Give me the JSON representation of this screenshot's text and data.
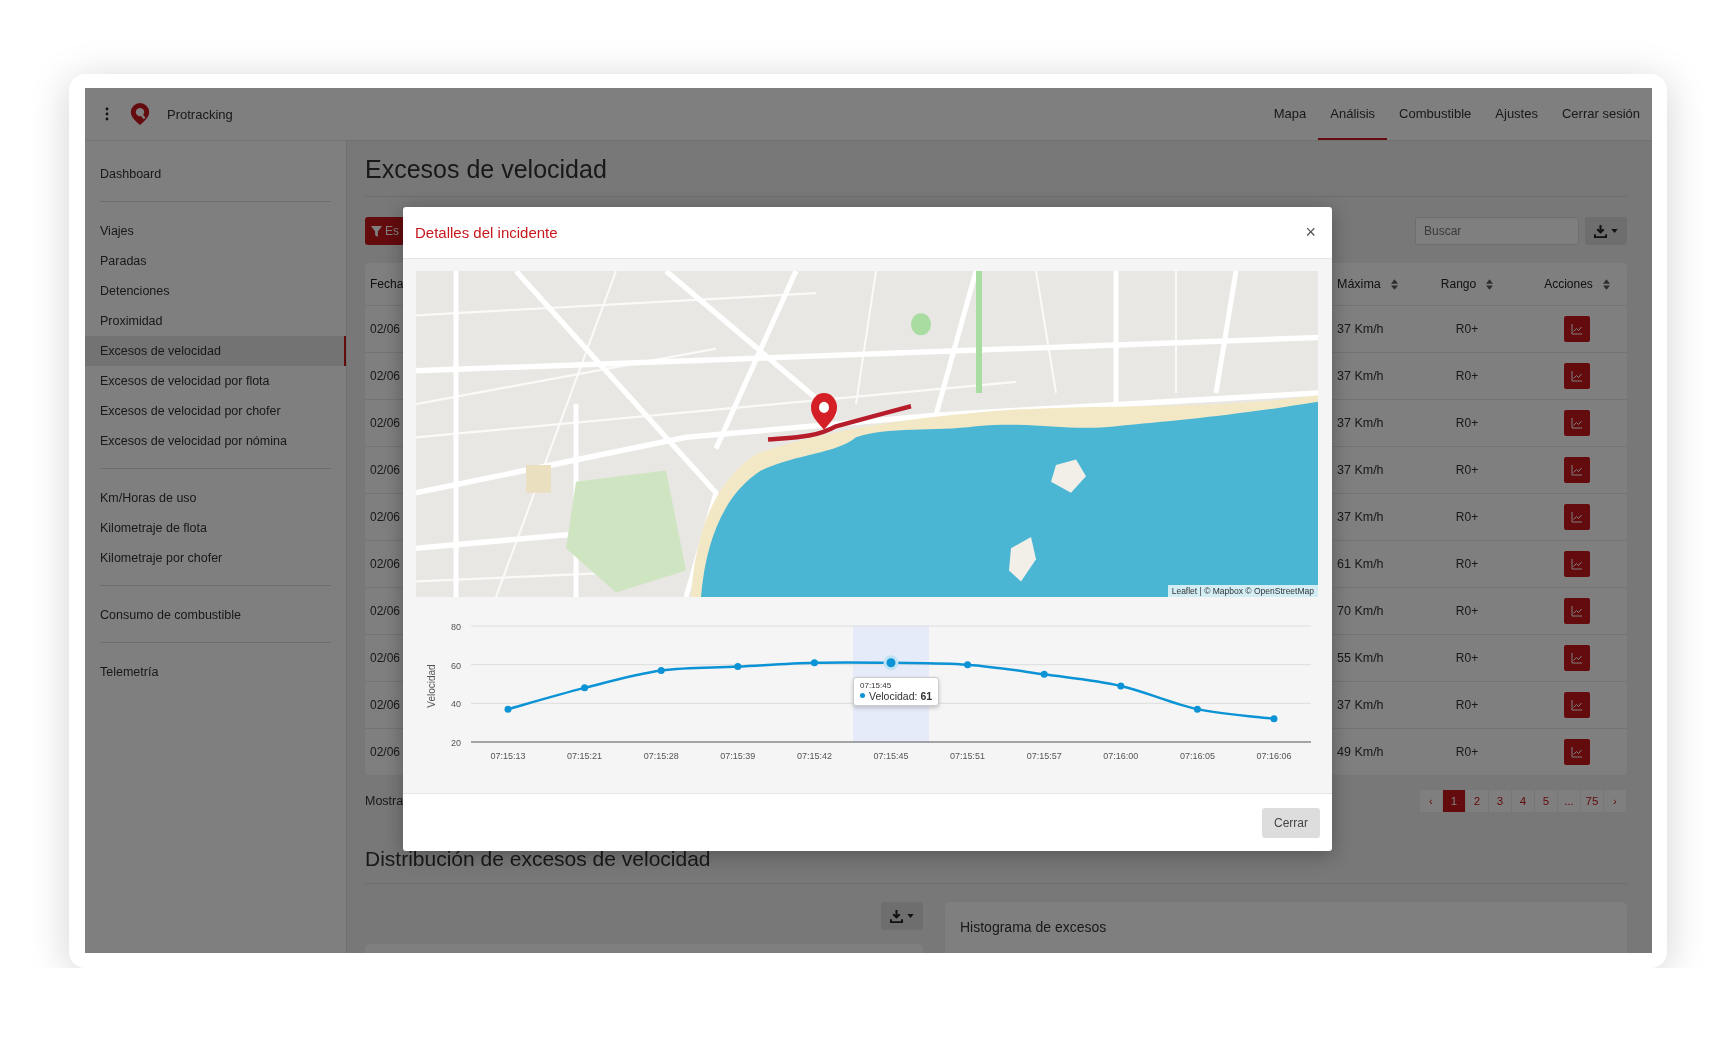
{
  "app": {
    "name": "Protracking"
  },
  "nav": [
    {
      "label": "Mapa",
      "selected": false
    },
    {
      "label": "Análisis",
      "selected": true
    },
    {
      "label": "Combustible",
      "selected": false
    },
    {
      "label": "Ajustes",
      "selected": false
    },
    {
      "label": "Cerrar sesión",
      "selected": false
    }
  ],
  "sidebar": {
    "groups": [
      {
        "items": [
          {
            "label": "Dashboard",
            "selected": false
          }
        ]
      },
      {
        "items": [
          {
            "label": "Viajes",
            "selected": false
          },
          {
            "label": "Paradas",
            "selected": false
          },
          {
            "label": "Detenciones",
            "selected": false
          },
          {
            "label": "Proximidad",
            "selected": false
          },
          {
            "label": "Excesos de velocidad",
            "selected": true
          },
          {
            "label": "Excesos de velocidad por flota",
            "selected": false
          },
          {
            "label": "Excesos de velocidad por chofer",
            "selected": false
          },
          {
            "label": "Excesos de velocidad por nómina",
            "selected": false
          }
        ]
      },
      {
        "items": [
          {
            "label": "Km/Horas de uso",
            "selected": false
          },
          {
            "label": "Kilometraje de flota",
            "selected": false
          },
          {
            "label": "Kilometraje por chofer",
            "selected": false
          }
        ]
      },
      {
        "items": [
          {
            "label": "Consumo de combustible",
            "selected": false
          }
        ]
      },
      {
        "items": [
          {
            "label": "Telemetría",
            "selected": false
          }
        ]
      }
    ]
  },
  "page": {
    "title": "Excesos de velocidad",
    "filter_button": "Es",
    "search": {
      "placeholder": "Buscar"
    },
    "table": {
      "columns": [
        {
          "label": "Fecha"
        },
        {
          "label": "Máxima",
          "sortable": true
        },
        {
          "label": "Rango",
          "sortable": true
        },
        {
          "label": "Acciones",
          "sortable": true
        }
      ],
      "rows": [
        {
          "date": "02/06",
          "max": "37 Km/h",
          "range": "R0+"
        },
        {
          "date": "02/06",
          "max": "37 Km/h",
          "range": "R0+"
        },
        {
          "date": "02/06",
          "max": "37 Km/h",
          "range": "R0+"
        },
        {
          "date": "02/06",
          "max": "37 Km/h",
          "range": "R0+"
        },
        {
          "date": "02/06",
          "max": "37 Km/h",
          "range": "R0+"
        },
        {
          "date": "02/06",
          "max": "61 Km/h",
          "range": "R0+"
        },
        {
          "date": "02/06",
          "max": "70 Km/h",
          "range": "R0+"
        },
        {
          "date": "02/06",
          "max": "55 Km/h",
          "range": "R0+"
        },
        {
          "date": "02/06",
          "max": "37 Km/h",
          "range": "R0+"
        },
        {
          "date": "02/06",
          "max": "49 Km/h",
          "range": "R0+"
        }
      ]
    },
    "footer_text": "Mostra",
    "pagination": [
      {
        "label": "‹",
        "selected": false
      },
      {
        "label": "1",
        "selected": true
      },
      {
        "label": "2",
        "selected": false
      },
      {
        "label": "3",
        "selected": false
      },
      {
        "label": "4",
        "selected": false
      },
      {
        "label": "5",
        "selected": false
      },
      {
        "label": "...",
        "selected": false
      },
      {
        "label": "75",
        "selected": false
      },
      {
        "label": "›",
        "selected": false
      }
    ]
  },
  "section": {
    "title": "Distribución de excesos de velocidad",
    "histogram_title": "Histograma de excesos"
  },
  "modal": {
    "title": "Detalles del incidente",
    "close": "×",
    "map": {
      "attribution": "Leaflet | © Mapbox © OpenStreetMap"
    },
    "chart_data": {
      "type": "line",
      "ylabel": "Velocidad",
      "categories": [
        "07:15:13",
        "07:15:21",
        "07:15:28",
        "07:15:39",
        "07:15:42",
        "07:15:45",
        "07:15:51",
        "07:15:57",
        "07:16:00",
        "07:16:05",
        "07:16:06"
      ],
      "series": [
        {
          "color": "#0b93d5",
          "marker": true,
          "values": [
            37,
            48,
            57,
            59,
            61,
            61,
            60,
            55,
            49,
            37,
            32
          ]
        }
      ],
      "ylim": [
        20,
        80
      ],
      "yticks": [
        20,
        40,
        60,
        80
      ],
      "annotations": [
        {
          "x": "07:15:45",
          "y": 61,
          "text": "Velocidad: **61**"
        }
      ]
    },
    "tooltip_time": "07:15:45",
    "button": "Cerrar"
  }
}
